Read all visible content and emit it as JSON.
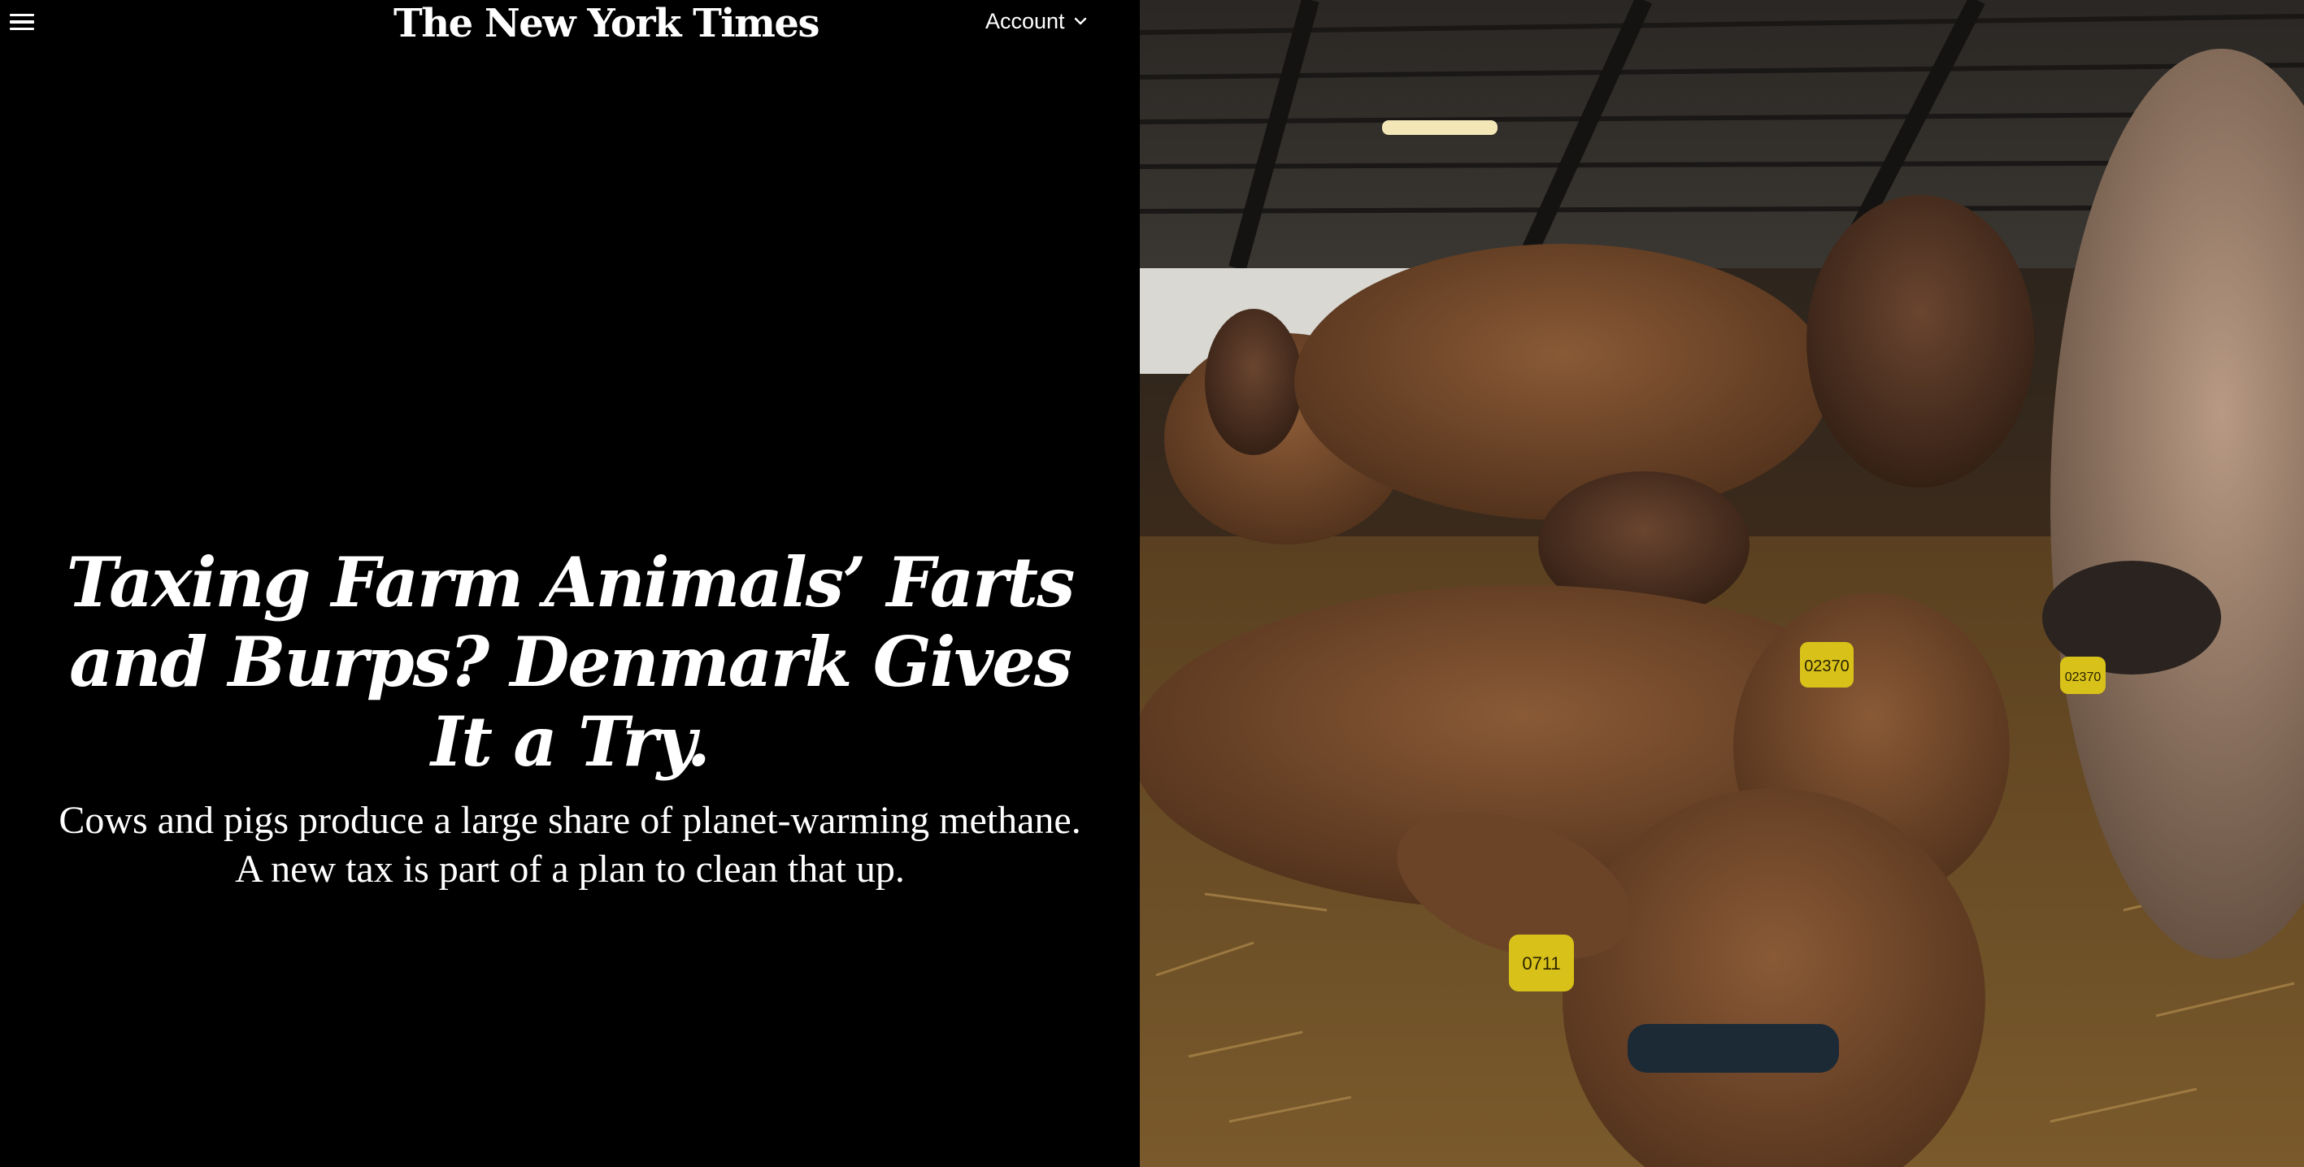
{
  "header": {
    "menu_icon": "hamburger-menu-icon",
    "masthead": "The New York Times",
    "account_label": "Account",
    "account_icon": "chevron-down-icon"
  },
  "article": {
    "headline": "Taxing Farm Animals’ Farts and Burps? Denmark Gives It a Try.",
    "dek": "Cows and pigs produce a large share of planet-warming methane. A new tax is part of a plan to clean that up."
  },
  "photo": {
    "ear_tags": [
      "02370",
      "02370",
      "0711"
    ]
  },
  "colors": {
    "background": "#000000",
    "text": "#ffffff",
    "ear_tag": "#d8c21a"
  }
}
